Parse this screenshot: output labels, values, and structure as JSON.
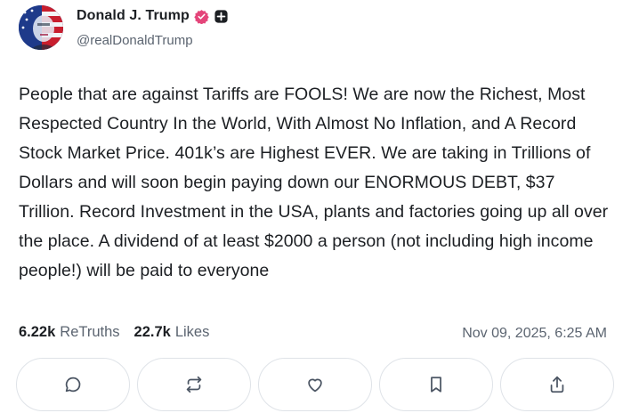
{
  "author": {
    "display_name": "Donald J. Trump",
    "handle": "@realDonaldTrump",
    "avatar_icon": "profile-avatar",
    "verified_badge_color": "#e4457a"
  },
  "post": {
    "text": "People that are against Tariffs are FOOLS! We are now the Richest, Most Respected Country In the World, With Almost No Inflation, and A Record Stock Market Price. 401k’s are Highest EVER. We are taking in Trillions of Dollars and will soon begin paying down our ENORMOUS DEBT, $37 Trillion. Record Investment in the USA, plants and factories going up all over the place. A dividend of at least $2000 a person (not including high income people!) will be paid to everyone"
  },
  "stats": {
    "retruths_count": "6.22k",
    "retruths_label": "ReTruths",
    "likes_count": "22.7k",
    "likes_label": "Likes",
    "timestamp": "Nov 09, 2025, 6:25 AM"
  },
  "actions": [
    {
      "name": "reply",
      "icon": "comment-icon"
    },
    {
      "name": "retruth",
      "icon": "repost-icon"
    },
    {
      "name": "like",
      "icon": "heart-icon"
    },
    {
      "name": "bookmark",
      "icon": "bookmark-icon"
    },
    {
      "name": "share",
      "icon": "share-icon"
    }
  ]
}
